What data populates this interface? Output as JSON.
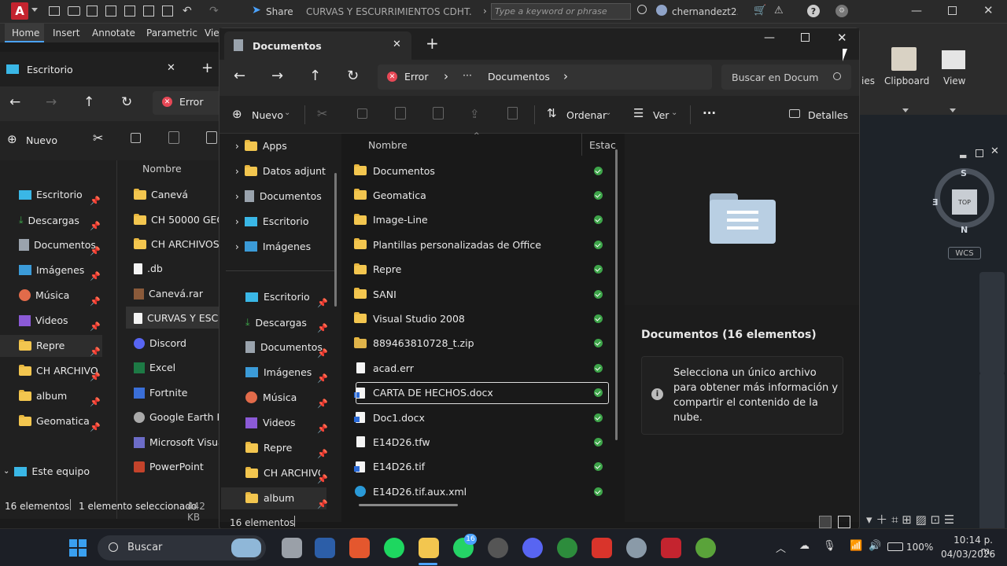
{
  "acad": {
    "share": "Share",
    "doc_title": "CURVAS Y ESCURRIMIENTOS CDHT.d...",
    "search_placeholder": "Type a keyword or phrase",
    "user": "chernandezt2...",
    "logo": "A"
  },
  "ribbon": {
    "tabs": [
      "Home",
      "Insert",
      "Annotate",
      "Parametric",
      "Vie"
    ]
  },
  "left_explorer": {
    "tab_title": "Escritorio",
    "path": "Error",
    "new_label": "Nuevo",
    "col_name": "Nombre",
    "quick": [
      {
        "label": "Escritorio",
        "icon": "desktop-icon"
      },
      {
        "label": "Descargas",
        "icon": "download-icon"
      },
      {
        "label": "Documentos",
        "icon": "document-icon"
      },
      {
        "label": "Imágenes",
        "icon": "image-icon"
      },
      {
        "label": "Música",
        "icon": "music-icon"
      },
      {
        "label": "Videos",
        "icon": "video-icon"
      },
      {
        "label": "Repre",
        "icon": "folder-icon"
      },
      {
        "label": "CH ARCHIVO",
        "icon": "folder-icon"
      },
      {
        "label": "album",
        "icon": "folder-icon"
      },
      {
        "label": "Geomatica",
        "icon": "folder-icon"
      }
    ],
    "este_equipo": "Este equipo",
    "files": [
      "Canevá",
      "CH 50000 GEO",
      "CH ARCHIVOS G",
      ".db",
      "Canevá.rar",
      "CURVAS Y ESCU",
      "Discord",
      "Excel",
      "Fortnite",
      "Google Earth Pro",
      "Microsoft Visual",
      "PowerPoint"
    ],
    "status": {
      "count": "16 elementos",
      "selected": "1 elemento seleccionado",
      "size": "442 KB"
    }
  },
  "main": {
    "tab_title": "Documentos",
    "breadcrumb": {
      "error": "Error",
      "ellipsis": "···",
      "current": "Documentos"
    },
    "search_placeholder": "Buscar en Docum",
    "cmd": {
      "new": "Nuevo",
      "sort": "Ordenar",
      "view": "Ver",
      "more": "···",
      "details": "Detalles"
    },
    "nav_tree": [
      "Apps",
      "Datos adjuntos",
      "Documentos",
      "Escritorio",
      "Imágenes"
    ],
    "nav_quick": [
      "Escritorio",
      "Descargas",
      "Documentos",
      "Imágenes",
      "Música",
      "Videos",
      "Repre",
      "CH ARCHIVO",
      "album"
    ],
    "columns": {
      "name": "Nombre",
      "status": "Estac"
    },
    "files": [
      {
        "name": "Documentos",
        "type": "folder"
      },
      {
        "name": "Geomatica",
        "type": "folder"
      },
      {
        "name": "Image-Line",
        "type": "folder"
      },
      {
        "name": "Plantillas personalizadas de Office",
        "type": "folder"
      },
      {
        "name": "Repre",
        "type": "folder"
      },
      {
        "name": "SANI",
        "type": "folder"
      },
      {
        "name": "Visual Studio 2008",
        "type": "folder"
      },
      {
        "name": "889463810728_t.zip",
        "type": "zip"
      },
      {
        "name": "acad.err",
        "type": "file"
      },
      {
        "name": "CARTA DE HECHOS.docx",
        "type": "docx"
      },
      {
        "name": "Doc1.docx",
        "type": "docx"
      },
      {
        "name": "E14D26.tfw",
        "type": "file"
      },
      {
        "name": "E14D26.tif",
        "type": "image"
      },
      {
        "name": "E14D26.tif.aux.xml",
        "type": "edge"
      }
    ],
    "details": {
      "title": "Documentos (16 elementos)",
      "info": "Selecciona un único archivo para obtener más información y compartir el contenido de la nube."
    },
    "status": "16 elementos"
  },
  "right_panel": {
    "clipboard": "Clipboard",
    "view": "View",
    "ies": "ies",
    "compass": {
      "n": "N",
      "s": "S",
      "e": "E",
      "top": "TOP"
    },
    "wcs": "WCS"
  },
  "taskbar": {
    "search": "Buscar",
    "battery": "100%",
    "time": "10:14 p. m.",
    "date": "04/03/2026",
    "badge": "16"
  },
  "colors": {
    "accent": "#0067c0",
    "folder": "#f3c64f",
    "check": "#3ea54a",
    "error": "#e74856"
  }
}
